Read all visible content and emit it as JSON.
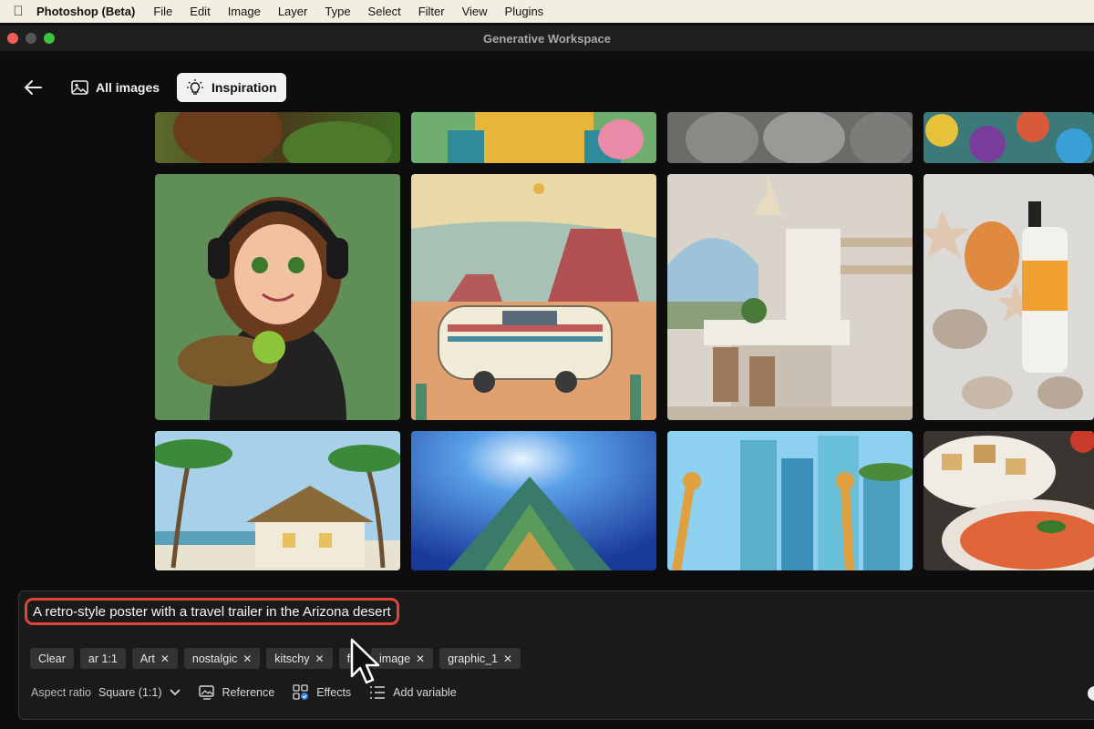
{
  "menubar": {
    "app_name": "Photoshop (Beta)",
    "items": [
      "File",
      "Edit",
      "Image",
      "Layer",
      "Type",
      "Select",
      "Filter",
      "View",
      "Plugins"
    ]
  },
  "window": {
    "title": "Generative Workspace"
  },
  "toolbar": {
    "back_icon": "arrow-left-icon",
    "tabs": [
      {
        "label": "All images",
        "icon": "image-icon",
        "selected": false
      },
      {
        "label": "Inspiration",
        "icon": "lightbulb-icon",
        "selected": true
      }
    ]
  },
  "gallery": {
    "rows": [
      [
        "green forest animal close-up",
        "colorful cartoon character",
        "stone statue figures",
        "colorful mosaic"
      ],
      [
        "cartoon girl with headphones holding a turtle",
        "retro travel trailer in desert",
        "modern kitchen with arched window",
        "orange serum bottle with seashells"
      ],
      [
        "thatched house with palm trees",
        "starry sky above mountain",
        "giraffes in futuristic city",
        "tomato soup with bread"
      ]
    ]
  },
  "prompt": {
    "text": "A retro-style poster with a travel trailer in the Arizona desert",
    "chips": [
      {
        "label": "Clear",
        "removable": false
      },
      {
        "label": "ar 1:1",
        "removable": false
      },
      {
        "label": "Art",
        "removable": true
      },
      {
        "label": "nostalgic",
        "removable": true
      },
      {
        "label": "kitschy",
        "removable": true
      },
      {
        "label": "fa",
        "removable": false
      },
      {
        "label": "image",
        "removable": true
      },
      {
        "label": "graphic_1",
        "removable": true
      }
    ],
    "options": {
      "aspect_ratio_label": "Aspect ratio",
      "aspect_ratio_value": "Square (1:1)",
      "reference_label": "Reference",
      "effects_label": "Effects",
      "add_variable_label": "Add variable"
    }
  },
  "colors": {
    "highlight": "#e0443d",
    "selected_tab_bg": "#f2f2f2",
    "menubar_bg": "#f3eee2"
  }
}
